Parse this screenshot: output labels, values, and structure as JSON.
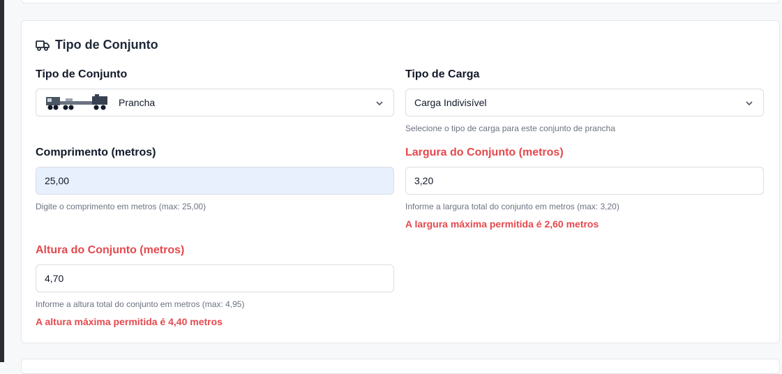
{
  "section": {
    "title": "Tipo de Conjunto",
    "icon": "truck-icon"
  },
  "fields": {
    "tipo_conjunto": {
      "label": "Tipo de Conjunto",
      "value": "Prancha",
      "icon": "prancha-truck-image"
    },
    "tipo_carga": {
      "label": "Tipo de Carga",
      "value": "Carga Indivisível",
      "help": "Selecione o tipo de carga para este conjunto de prancha"
    },
    "comprimento": {
      "label": "Comprimento (metros)",
      "value": "25,00",
      "help": "Digite o comprimento em metros (max: 25,00)"
    },
    "largura": {
      "label": "Largura do Conjunto (metros)",
      "value": "3,20",
      "help": "Informe a largura total do conjunto em metros (max: 3,20)",
      "error": "A largura máxima permitida é 2,60 metros"
    },
    "altura": {
      "label": "Altura do Conjunto (metros)",
      "value": "4,70",
      "help": "Informe a altura total do conjunto em metros (max: 4,95)",
      "error": "A altura máxima permitida é 4,40 metros"
    }
  },
  "colors": {
    "error": "#e5484d",
    "autofill": "#e8f0fe",
    "border": "#d9dde3"
  }
}
